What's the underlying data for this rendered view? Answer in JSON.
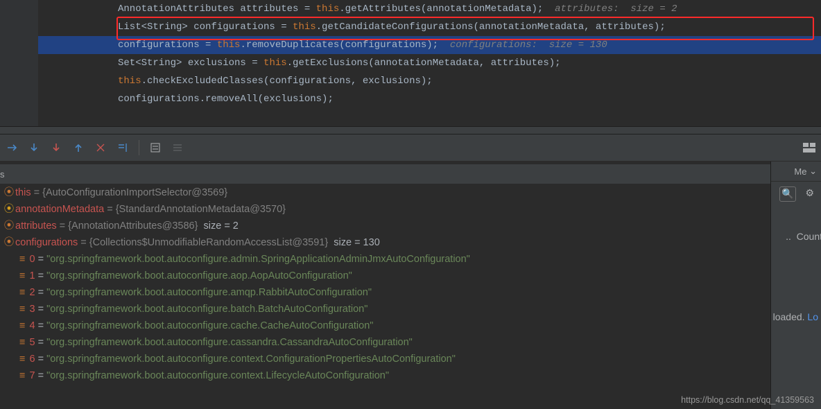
{
  "code": {
    "l1_pre": "AnnotationAttributes attributes = ",
    "l1_kw": "this",
    "l1_post": ".getAttributes(annotationMetadata);",
    "l1_cmt": "  attributes:  size = 2",
    "l2_pre": "List<String> configurations = ",
    "l2_kw": "this",
    "l2_post": ".getCandidateConfigurations(annotationMetadata, attributes);",
    "l3_pre": "configurations = ",
    "l3_kw": "this",
    "l3_post": ".removeDuplicates(configurations);",
    "l3_cmt": "  configurations:  size = 130",
    "l4_pre": "Set<String> exclusions = ",
    "l4_kw": "this",
    "l4_post": ".getExclusions(annotationMetadata, attributes);",
    "l5_kw": "this",
    "l5_post": ".checkExcludedClasses(configurations, exclusions);",
    "l6": "configurations.removeAll(exclusions);"
  },
  "tab": {
    "label": "Me"
  },
  "side": {
    "count": "Count",
    "dots": "..",
    "status": "loaded.",
    "link": "Lo"
  },
  "vars": {
    "this_name": "this",
    "this_val": " = {AutoConfigurationImportSelector@3569}",
    "am_name": "annotationMetadata",
    "am_val": " = {StandardAnnotationMetadata@3570}",
    "attr_name": "attributes",
    "attr_val": " = {AnnotationAttributes@3586}  ",
    "attr_size": "size = 2",
    "cfg_name": "configurations",
    "cfg_val": " = {Collections$UnmodifiableRandomAccessList@3591}  ",
    "cfg_size": "size = 130",
    "items": [
      {
        "i": "0",
        "v": "\"org.springframework.boot.autoconfigure.admin.SpringApplicationAdminJmxAutoConfiguration\""
      },
      {
        "i": "1",
        "v": "\"org.springframework.boot.autoconfigure.aop.AopAutoConfiguration\""
      },
      {
        "i": "2",
        "v": "\"org.springframework.boot.autoconfigure.amqp.RabbitAutoConfiguration\""
      },
      {
        "i": "3",
        "v": "\"org.springframework.boot.autoconfigure.batch.BatchAutoConfiguration\""
      },
      {
        "i": "4",
        "v": "\"org.springframework.boot.autoconfigure.cache.CacheAutoConfiguration\""
      },
      {
        "i": "5",
        "v": "\"org.springframework.boot.autoconfigure.cassandra.CassandraAutoConfiguration\""
      },
      {
        "i": "6",
        "v": "\"org.springframework.boot.autoconfigure.context.ConfigurationPropertiesAutoConfiguration\""
      },
      {
        "i": "7",
        "v": "\"org.springframework.boot.autoconfigure.context.LifecycleAutoConfiguration\""
      }
    ]
  },
  "watermark": "https://blog.csdn.net/qq_41359563"
}
